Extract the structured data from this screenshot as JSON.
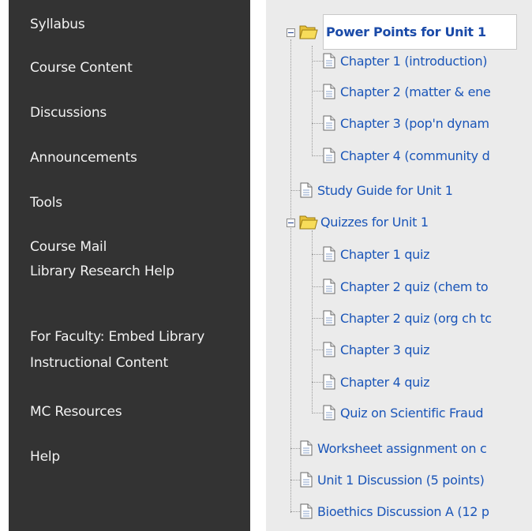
{
  "sidebar": {
    "items": [
      {
        "label": "Syllabus"
      },
      {
        "label": "Course Content"
      },
      {
        "label": "Discussions"
      },
      {
        "label": "Announcements"
      },
      {
        "label": "Tools"
      },
      {
        "label": "Course Mail"
      },
      {
        "label": "Library Research Help"
      },
      {
        "label": "For Faculty: Embed Library",
        "label2": "Instructional Content"
      },
      {
        "label": "MC Resources"
      },
      {
        "label": "Help"
      }
    ]
  },
  "tree": {
    "power_points": {
      "label": "Power Points for Unit 1",
      "children": [
        {
          "label": "Chapter 1 (introduction)"
        },
        {
          "label": "Chapter 2 (matter & ene"
        },
        {
          "label": "Chapter 3 (pop'n dynam"
        },
        {
          "label": "Chapter 4 (community d"
        }
      ]
    },
    "study_guide": {
      "label": "Study Guide for Unit 1"
    },
    "quizzes": {
      "label": "Quizzes for Unit 1",
      "children": [
        {
          "label": "Chapter 1 quiz"
        },
        {
          "label": "Chapter 2 quiz (chem to"
        },
        {
          "label": "Chapter 2 quiz (org ch tc"
        },
        {
          "label": "Chapter 3 quiz"
        },
        {
          "label": "Chapter 4 quiz"
        },
        {
          "label": "Quiz on Scientific Fraud"
        }
      ]
    },
    "worksheet": {
      "label": "Worksheet assignment on c"
    },
    "unit1_discussion": {
      "label": "Unit 1 Discussion (5 points)"
    },
    "bioethics": {
      "label": "Bioethics Discussion A (12 p"
    }
  },
  "colors": {
    "sidebar_bg": "#333333",
    "sidebar_text": "#f2f2f2",
    "tree_bg": "#ebebeb",
    "link": "#1a55b8"
  }
}
